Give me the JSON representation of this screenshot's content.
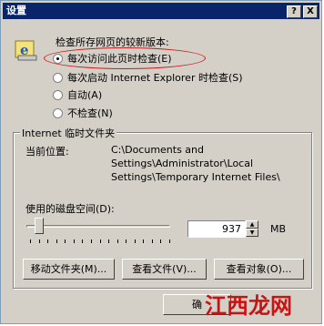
{
  "window": {
    "title": "设置",
    "help_glyph": "?",
    "close_glyph": "X"
  },
  "check_label": "检查所存网页的较新版本:",
  "radios": [
    {
      "label": "每次访问此页时检查(E)",
      "selected": true
    },
    {
      "label": "每次启动 Internet Explorer 时检查(S)",
      "selected": false
    },
    {
      "label": "自动(A)",
      "selected": false
    },
    {
      "label": "不检查(N)",
      "selected": false
    }
  ],
  "temp_files": {
    "group_title": "Internet 临时文件夹",
    "location_label": "当前位置:",
    "location_lines": [
      "C:\\Documents and",
      "Settings\\Administrator\\Local",
      "Settings\\Temporary Internet Files\\"
    ],
    "disk_label": "使用的磁盘空间(D):",
    "disk_value": "937",
    "disk_unit": "MB",
    "slider_fraction": 0.06,
    "tick_count": 17
  },
  "buttons": {
    "move_folder": "移动文件夹(M)...",
    "view_files": "查看文件(V)...",
    "view_objects": "查看对象(O)...",
    "ok": "确"
  },
  "watermark": "江西龙网",
  "colors": {
    "titlebar": "#0a246a",
    "highlight_ring": "#d01818",
    "dialog_face": "#d4d0c8"
  },
  "icons": {
    "ie_logo": "internet-explorer-icon"
  }
}
